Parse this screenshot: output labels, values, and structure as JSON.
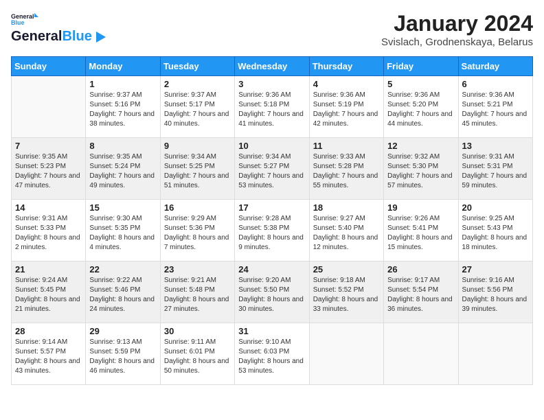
{
  "logo": {
    "text_general": "General",
    "text_blue": "Blue"
  },
  "title": "January 2024",
  "subtitle": "Svislach, Grodnenskaya, Belarus",
  "days_of_week": [
    "Sunday",
    "Monday",
    "Tuesday",
    "Wednesday",
    "Thursday",
    "Friday",
    "Saturday"
  ],
  "weeks": [
    [
      {
        "day": "",
        "sunrise": "",
        "sunset": "",
        "daylight": ""
      },
      {
        "day": "1",
        "sunrise": "Sunrise: 9:37 AM",
        "sunset": "Sunset: 5:16 PM",
        "daylight": "Daylight: 7 hours and 38 minutes."
      },
      {
        "day": "2",
        "sunrise": "Sunrise: 9:37 AM",
        "sunset": "Sunset: 5:17 PM",
        "daylight": "Daylight: 7 hours and 40 minutes."
      },
      {
        "day": "3",
        "sunrise": "Sunrise: 9:36 AM",
        "sunset": "Sunset: 5:18 PM",
        "daylight": "Daylight: 7 hours and 41 minutes."
      },
      {
        "day": "4",
        "sunrise": "Sunrise: 9:36 AM",
        "sunset": "Sunset: 5:19 PM",
        "daylight": "Daylight: 7 hours and 42 minutes."
      },
      {
        "day": "5",
        "sunrise": "Sunrise: 9:36 AM",
        "sunset": "Sunset: 5:20 PM",
        "daylight": "Daylight: 7 hours and 44 minutes."
      },
      {
        "day": "6",
        "sunrise": "Sunrise: 9:36 AM",
        "sunset": "Sunset: 5:21 PM",
        "daylight": "Daylight: 7 hours and 45 minutes."
      }
    ],
    [
      {
        "day": "7",
        "sunrise": "Sunrise: 9:35 AM",
        "sunset": "Sunset: 5:23 PM",
        "daylight": "Daylight: 7 hours and 47 minutes."
      },
      {
        "day": "8",
        "sunrise": "Sunrise: 9:35 AM",
        "sunset": "Sunset: 5:24 PM",
        "daylight": "Daylight: 7 hours and 49 minutes."
      },
      {
        "day": "9",
        "sunrise": "Sunrise: 9:34 AM",
        "sunset": "Sunset: 5:25 PM",
        "daylight": "Daylight: 7 hours and 51 minutes."
      },
      {
        "day": "10",
        "sunrise": "Sunrise: 9:34 AM",
        "sunset": "Sunset: 5:27 PM",
        "daylight": "Daylight: 7 hours and 53 minutes."
      },
      {
        "day": "11",
        "sunrise": "Sunrise: 9:33 AM",
        "sunset": "Sunset: 5:28 PM",
        "daylight": "Daylight: 7 hours and 55 minutes."
      },
      {
        "day": "12",
        "sunrise": "Sunrise: 9:32 AM",
        "sunset": "Sunset: 5:30 PM",
        "daylight": "Daylight: 7 hours and 57 minutes."
      },
      {
        "day": "13",
        "sunrise": "Sunrise: 9:31 AM",
        "sunset": "Sunset: 5:31 PM",
        "daylight": "Daylight: 7 hours and 59 minutes."
      }
    ],
    [
      {
        "day": "14",
        "sunrise": "Sunrise: 9:31 AM",
        "sunset": "Sunset: 5:33 PM",
        "daylight": "Daylight: 8 hours and 2 minutes."
      },
      {
        "day": "15",
        "sunrise": "Sunrise: 9:30 AM",
        "sunset": "Sunset: 5:35 PM",
        "daylight": "Daylight: 8 hours and 4 minutes."
      },
      {
        "day": "16",
        "sunrise": "Sunrise: 9:29 AM",
        "sunset": "Sunset: 5:36 PM",
        "daylight": "Daylight: 8 hours and 7 minutes."
      },
      {
        "day": "17",
        "sunrise": "Sunrise: 9:28 AM",
        "sunset": "Sunset: 5:38 PM",
        "daylight": "Daylight: 8 hours and 9 minutes."
      },
      {
        "day": "18",
        "sunrise": "Sunrise: 9:27 AM",
        "sunset": "Sunset: 5:40 PM",
        "daylight": "Daylight: 8 hours and 12 minutes."
      },
      {
        "day": "19",
        "sunrise": "Sunrise: 9:26 AM",
        "sunset": "Sunset: 5:41 PM",
        "daylight": "Daylight: 8 hours and 15 minutes."
      },
      {
        "day": "20",
        "sunrise": "Sunrise: 9:25 AM",
        "sunset": "Sunset: 5:43 PM",
        "daylight": "Daylight: 8 hours and 18 minutes."
      }
    ],
    [
      {
        "day": "21",
        "sunrise": "Sunrise: 9:24 AM",
        "sunset": "Sunset: 5:45 PM",
        "daylight": "Daylight: 8 hours and 21 minutes."
      },
      {
        "day": "22",
        "sunrise": "Sunrise: 9:22 AM",
        "sunset": "Sunset: 5:46 PM",
        "daylight": "Daylight: 8 hours and 24 minutes."
      },
      {
        "day": "23",
        "sunrise": "Sunrise: 9:21 AM",
        "sunset": "Sunset: 5:48 PM",
        "daylight": "Daylight: 8 hours and 27 minutes."
      },
      {
        "day": "24",
        "sunrise": "Sunrise: 9:20 AM",
        "sunset": "Sunset: 5:50 PM",
        "daylight": "Daylight: 8 hours and 30 minutes."
      },
      {
        "day": "25",
        "sunrise": "Sunrise: 9:18 AM",
        "sunset": "Sunset: 5:52 PM",
        "daylight": "Daylight: 8 hours and 33 minutes."
      },
      {
        "day": "26",
        "sunrise": "Sunrise: 9:17 AM",
        "sunset": "Sunset: 5:54 PM",
        "daylight": "Daylight: 8 hours and 36 minutes."
      },
      {
        "day": "27",
        "sunrise": "Sunrise: 9:16 AM",
        "sunset": "Sunset: 5:56 PM",
        "daylight": "Daylight: 8 hours and 39 minutes."
      }
    ],
    [
      {
        "day": "28",
        "sunrise": "Sunrise: 9:14 AM",
        "sunset": "Sunset: 5:57 PM",
        "daylight": "Daylight: 8 hours and 43 minutes."
      },
      {
        "day": "29",
        "sunrise": "Sunrise: 9:13 AM",
        "sunset": "Sunset: 5:59 PM",
        "daylight": "Daylight: 8 hours and 46 minutes."
      },
      {
        "day": "30",
        "sunrise": "Sunrise: 9:11 AM",
        "sunset": "Sunset: 6:01 PM",
        "daylight": "Daylight: 8 hours and 50 minutes."
      },
      {
        "day": "31",
        "sunrise": "Sunrise: 9:10 AM",
        "sunset": "Sunset: 6:03 PM",
        "daylight": "Daylight: 8 hours and 53 minutes."
      },
      {
        "day": "",
        "sunrise": "",
        "sunset": "",
        "daylight": ""
      },
      {
        "day": "",
        "sunrise": "",
        "sunset": "",
        "daylight": ""
      },
      {
        "day": "",
        "sunrise": "",
        "sunset": "",
        "daylight": ""
      }
    ]
  ]
}
